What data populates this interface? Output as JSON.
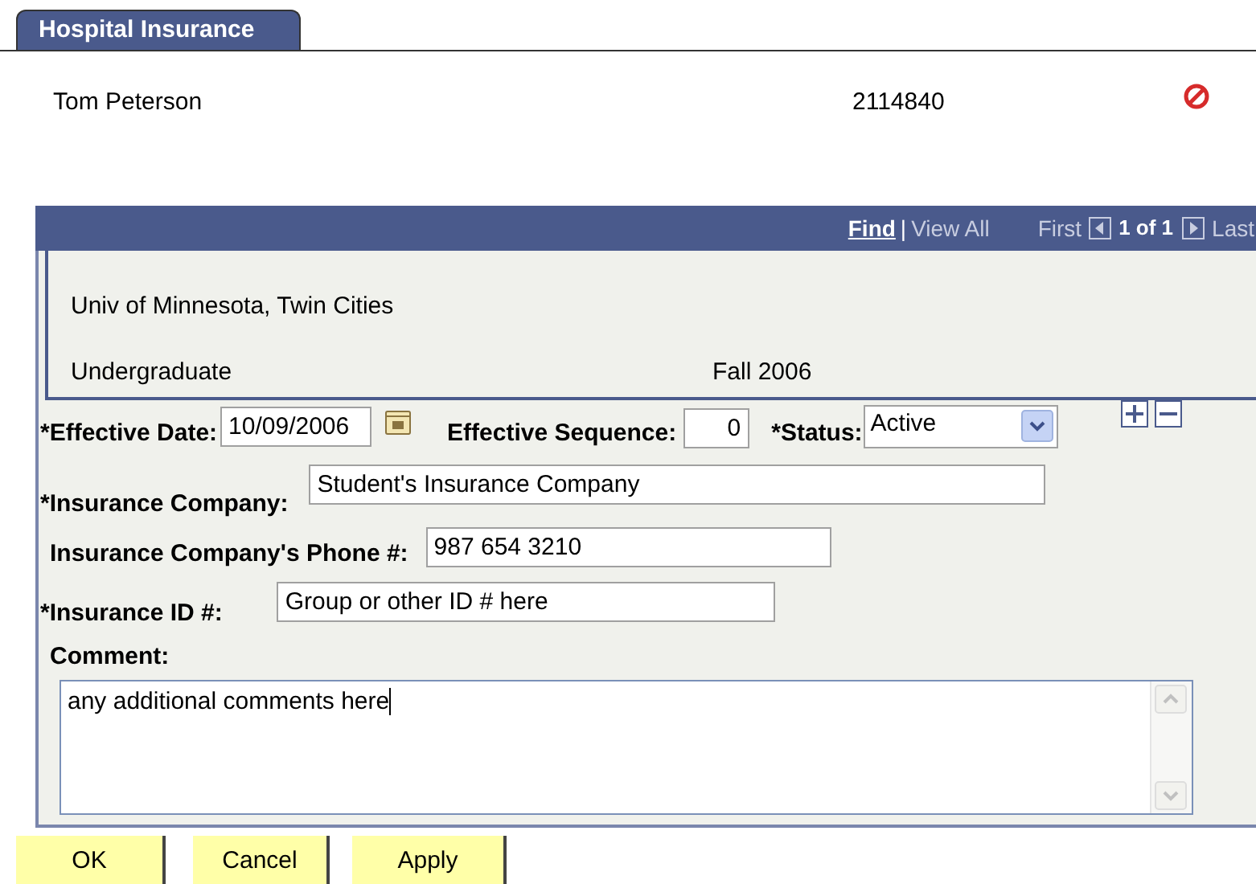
{
  "tab": {
    "label": "Hospital Insurance",
    "selected": true
  },
  "person": {
    "name": "Tom Peterson",
    "id": "2114840"
  },
  "grid_nav": {
    "find": "Find",
    "separator": "|",
    "view_all": "View All",
    "first": "First",
    "position": "1 of 1",
    "last": "Last"
  },
  "summary": {
    "institution": "Univ of Minnesota, Twin Cities",
    "career": "Undergraduate",
    "term": "Fall 2006"
  },
  "effective_date": {
    "label": "*Effective Date:",
    "value": "10/09/2006"
  },
  "effective_sequence": {
    "label": "Effective Sequence:",
    "value": "0"
  },
  "status": {
    "label": "*Status:",
    "value": "Active"
  },
  "insurance_company": {
    "label": "*Insurance Company:",
    "value": "Student's Insurance Company"
  },
  "phone": {
    "label": "Insurance Company's Phone #:",
    "value": "987 654 3210"
  },
  "insurance_id": {
    "label": "*Insurance ID #:",
    "value": "Group or other ID # here"
  },
  "comment": {
    "label": "Comment:",
    "value": "any additional comments here"
  },
  "buttons": [
    "OK",
    "Cancel",
    "Apply"
  ]
}
